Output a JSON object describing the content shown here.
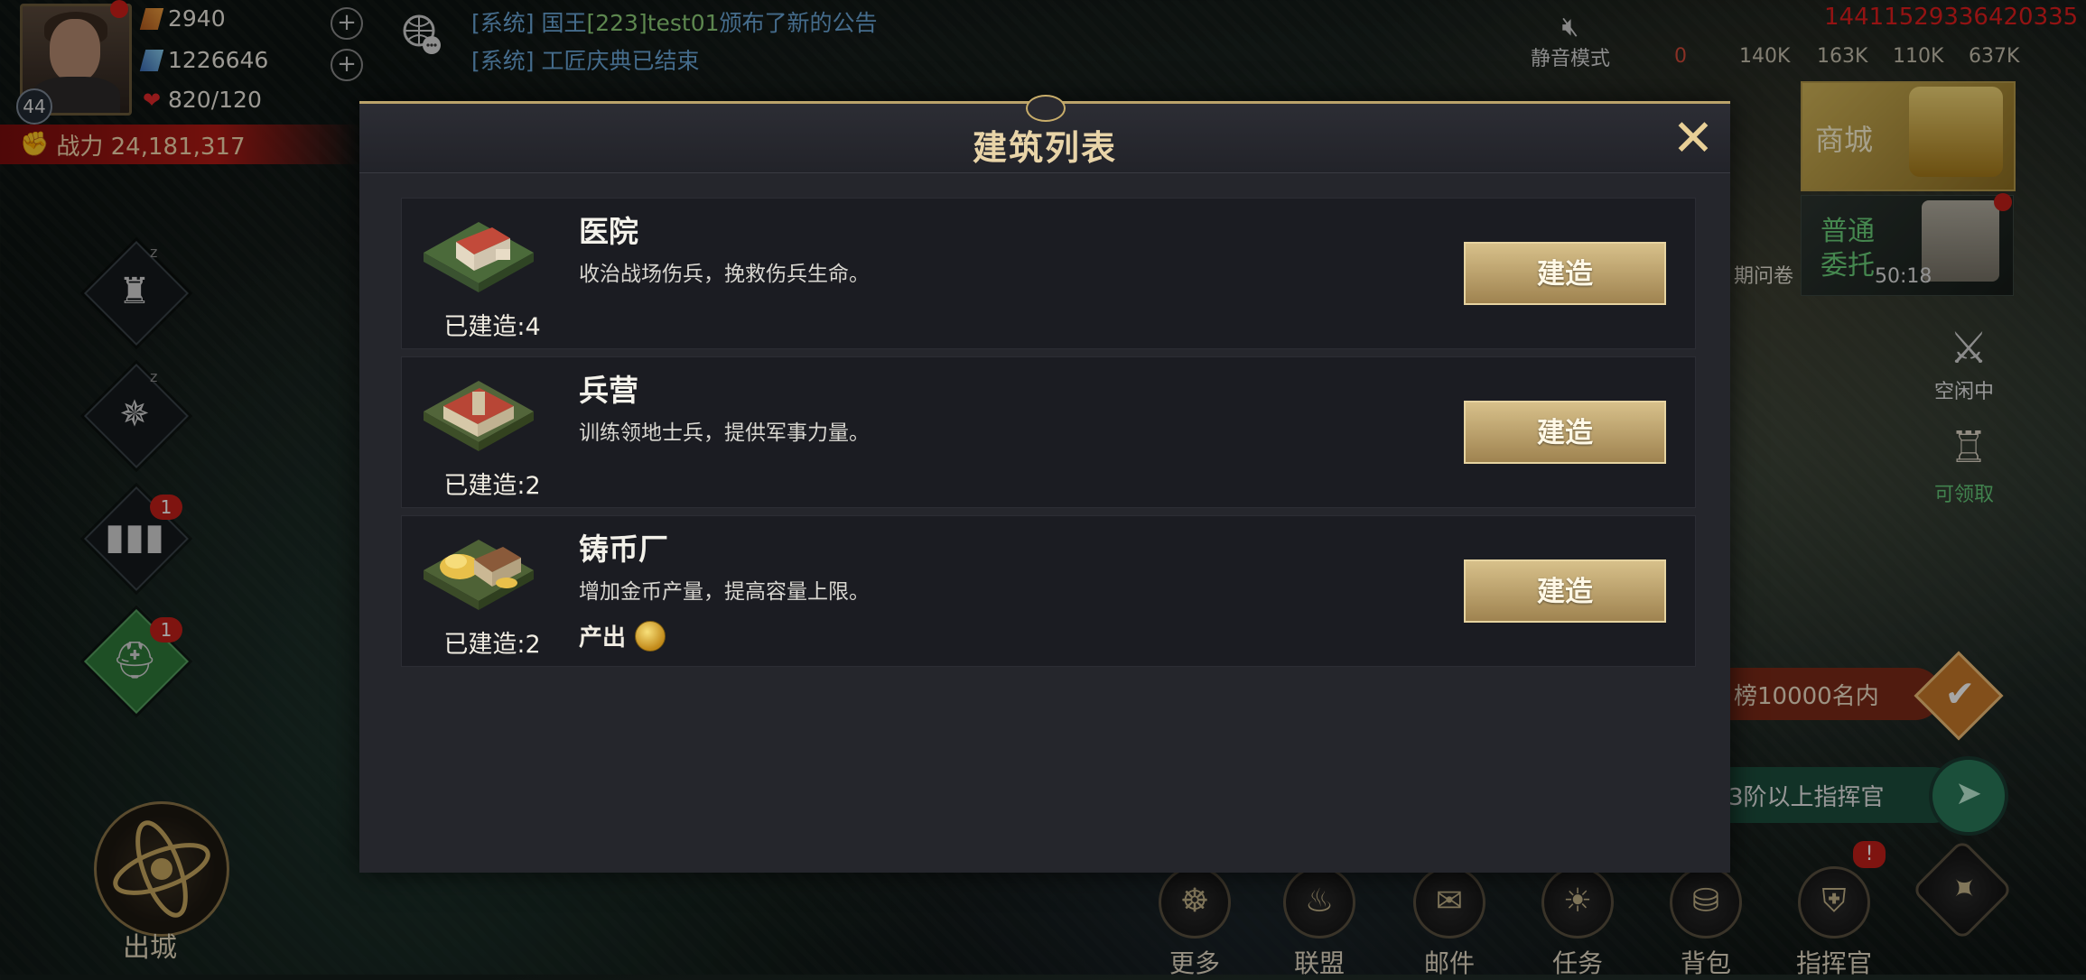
{
  "player": {
    "level": "44",
    "resources": [
      "2940",
      "1226646",
      "820/120"
    ],
    "power": "战力 24,181,317"
  },
  "chat": {
    "lines": [
      {
        "tag": "[系统]",
        "prefix": " 国王",
        "name": "[223]test01",
        "text": "颁布了新的公告"
      },
      {
        "tag": "[系统]",
        "prefix": " 工匠庆典已结束",
        "name": "",
        "text": ""
      }
    ]
  },
  "topbar": {
    "mute_label": "静音模式",
    "resources": [
      "0",
      "140K",
      "163K",
      "110K",
      "637K"
    ],
    "debug_id": "14411529336420335"
  },
  "side_left": {
    "badges": [
      "1",
      "1"
    ],
    "chucheng_label": "出城"
  },
  "side_right": {
    "shop_label": "商城",
    "weituo_label_1": "普通",
    "weituo_label_2": "委托",
    "timer": "50:18",
    "survey_label": "期问卷",
    "idle_label": "空闲中",
    "claim_label": "可领取",
    "rank_text": "榜10000名内",
    "commander_text": "3阶以上指挥官"
  },
  "bottom_menu": [
    {
      "label": "更多",
      "icon": "wheel-icon"
    },
    {
      "label": "联盟",
      "icon": "flame-banner-icon"
    },
    {
      "label": "邮件",
      "icon": "bird-mail-icon"
    },
    {
      "label": "任务",
      "icon": "sun-task-icon"
    },
    {
      "label": "背包",
      "icon": "bag-icon"
    },
    {
      "label": "指挥官",
      "icon": "helmet-icon"
    },
    {
      "label": "",
      "icon": "shuriken-icon"
    }
  ],
  "bottom_badge": "!",
  "modal": {
    "title": "建筑列表",
    "buildings": [
      {
        "name": "医院",
        "desc": "收治战场伤兵，挽救伤兵生命。",
        "built": "已建造:4",
        "button": "建造",
        "output": ""
      },
      {
        "name": "兵营",
        "desc": "训练领地士兵，提供军事力量。",
        "built": "已建造:2",
        "button": "建造",
        "output": ""
      },
      {
        "name": "铸币厂",
        "desc": "增加金币产量，提高容量上限。",
        "built": "已建造:2",
        "button": "建造",
        "output": "产出"
      }
    ]
  },
  "colors": {
    "accent_gold": "#bba36a",
    "button_gold": "#c8ad72",
    "chat_system": "#6aa6d8",
    "chat_name": "#8fd07a",
    "power_red": "#b01a14"
  }
}
